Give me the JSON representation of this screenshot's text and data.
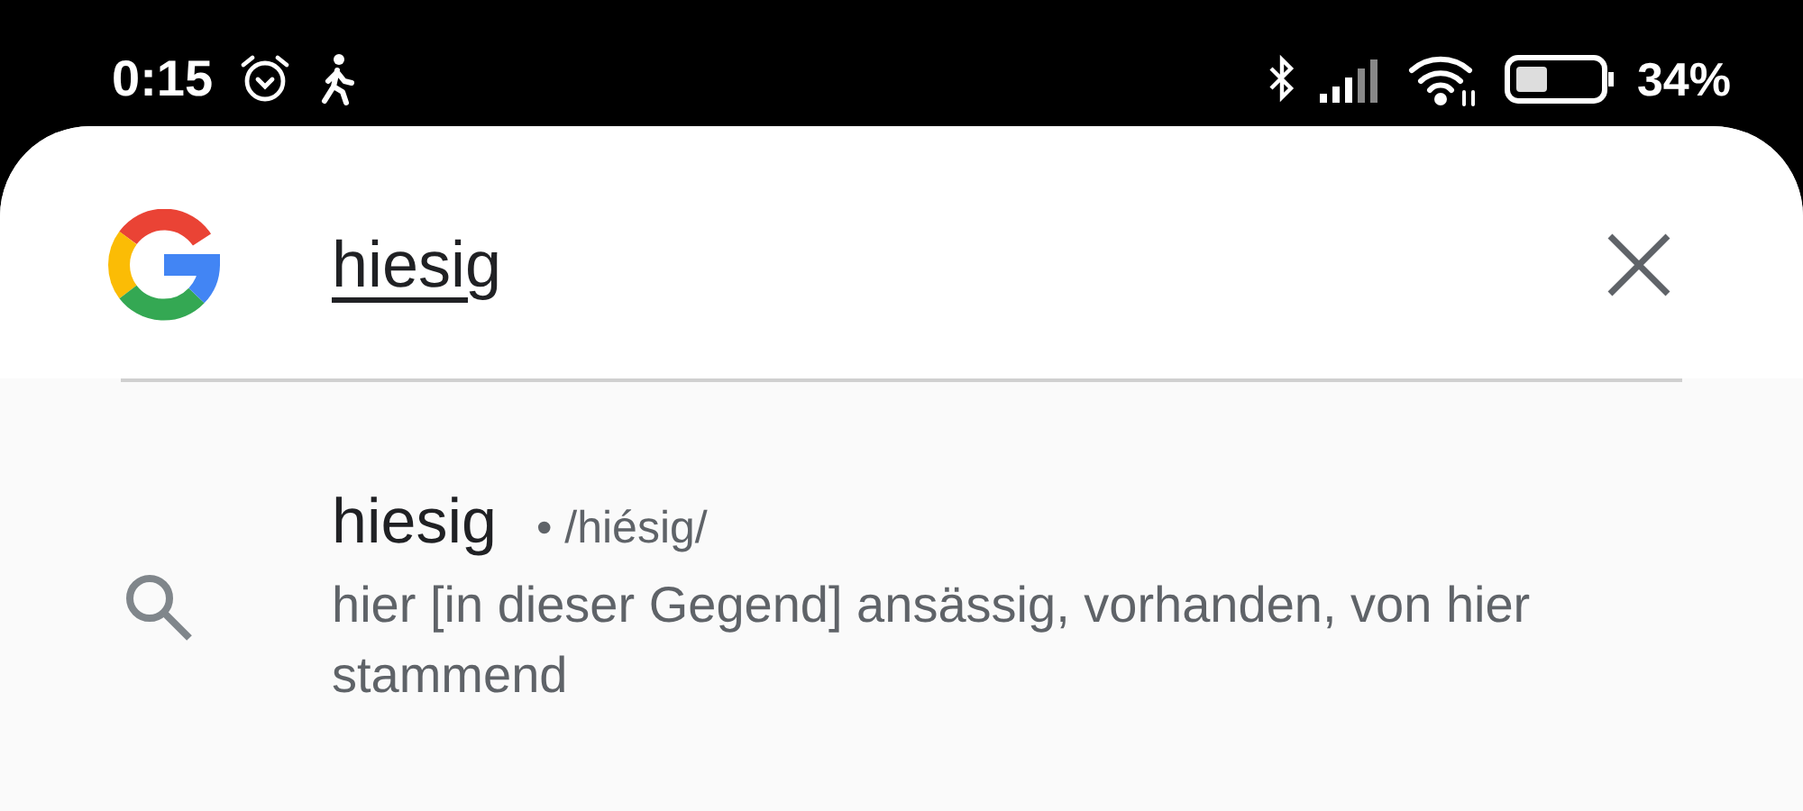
{
  "status_bar": {
    "time": "0:15",
    "battery": "34%"
  },
  "search": {
    "value": "hiesig"
  },
  "suggestions": [
    {
      "word": "hiesig",
      "pronunciation": "• /hiésig/",
      "definition": "hier [in dieser Gegend] ansässig, vorhanden, von hier stammend"
    }
  ]
}
